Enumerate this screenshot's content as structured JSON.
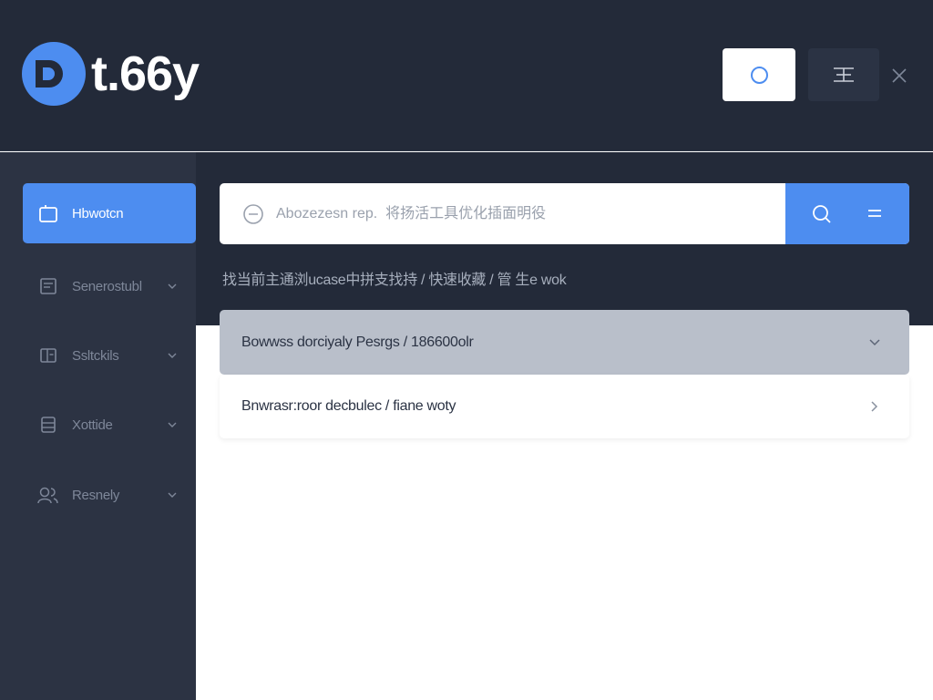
{
  "app": {
    "logo_text": "t.66y",
    "header_icons": {
      "primary": "circle-icon",
      "secondary": "list-icon",
      "close": "close-icon"
    }
  },
  "sidebar": {
    "items": [
      {
        "label": "Hbwotcn",
        "icon": "tablet-icon",
        "active": true
      },
      {
        "label": "Senerostubl",
        "icon": "document-icon",
        "active": false
      },
      {
        "label": "Ssltckils",
        "icon": "panel-icon",
        "active": false
      },
      {
        "label": "Xottide",
        "icon": "stack-icon",
        "active": false
      },
      {
        "label": "Resnely",
        "icon": "users-icon",
        "active": false
      }
    ]
  },
  "search": {
    "placeholder": "Abozezesn rep.  将扬活工具优化插面明役",
    "button_icon": "search-icon",
    "menu_icon": "menu-icon"
  },
  "breadcrumb": {
    "text": "找当前主通浏ucase中拼支找持 / 快速收藏 / 管 生e wok"
  },
  "list": {
    "rows": [
      {
        "label": "Bowwss dorciyaly  Pesrgs / 186600olr",
        "expanded": true
      },
      {
        "label": "Bnwrasr:roor decbulec / fiane woty",
        "expanded": false
      }
    ]
  },
  "colors": {
    "accent": "#4d8df0",
    "header_bg": "#232a39",
    "sidebar_bg": "#2c3343",
    "row_selected": "#b9bfca"
  }
}
